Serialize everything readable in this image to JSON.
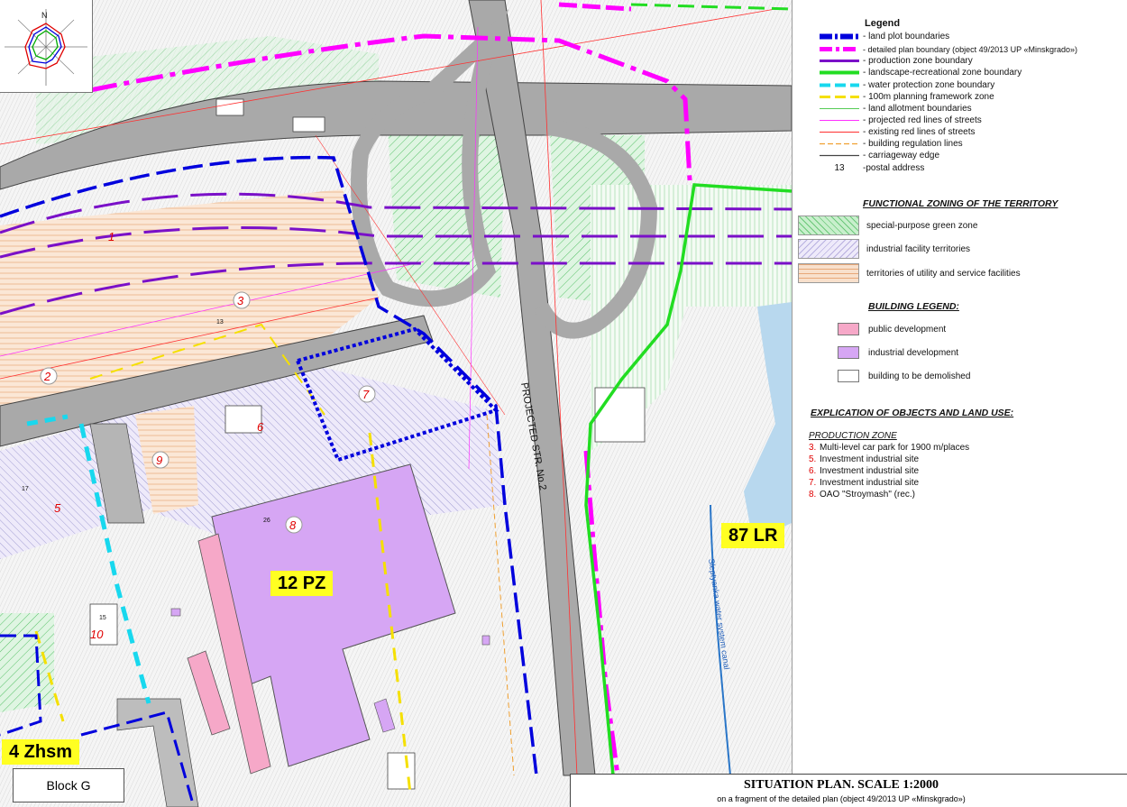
{
  "legend": {
    "title": "Legend",
    "items": [
      {
        "text": "- land plot boundaries",
        "color": "#0000dd",
        "style": "dash-bold"
      },
      {
        "text": "- detailed plan boundary (object 49/2013 UP «Minskgrado»)",
        "color": "#ff00ff",
        "style": "dashdot-bold"
      },
      {
        "text": "- production zone boundary",
        "color": "#7a10c8",
        "style": "solid"
      },
      {
        "text": "- landscape-recreational zone boundary",
        "color": "#22dd22",
        "style": "solid"
      },
      {
        "text": "- water protection zone boundary",
        "color": "#18d8ee",
        "style": "dash"
      },
      {
        "text": "- 100m planning framework zone",
        "color": "#f5e000",
        "style": "dash"
      },
      {
        "text": "- land allotment boundaries",
        "color": "#55cc55",
        "style": "thin"
      },
      {
        "text": "- projected red lines of streets",
        "color": "#ff30ff",
        "style": "thin"
      },
      {
        "text": "- existing red lines of streets",
        "color": "#ff3030",
        "style": "thin"
      },
      {
        "text": "- building regulation lines",
        "color": "#f0a030",
        "style": "thin-dash"
      },
      {
        "text": "- carriageway edge",
        "color": "#444444",
        "style": "thin"
      }
    ],
    "postal_number": "13",
    "postal_text": "-postal address"
  },
  "zoning": {
    "title": "FUNCTIONAL ZONING OF THE TERRITORY",
    "items": [
      {
        "text": "special-purpose green zone",
        "color": "#c8efcc"
      },
      {
        "text": "industrial facility territories",
        "color": "#eeeafa"
      },
      {
        "text": "territories of utility and service facilities",
        "color": "#f8e0cc"
      }
    ]
  },
  "buildings": {
    "title": "BUILDING LEGEND:",
    "items": [
      {
        "text": "public development",
        "color": "#f6a8c8"
      },
      {
        "text": "industrial development",
        "color": "#d6a6f4"
      },
      {
        "text": "building to be demolished",
        "color": "#ffffff"
      }
    ]
  },
  "explication": {
    "title": "EXPLICATION OF OBJECTS AND LAND USE:",
    "subtitle": "PRODUCTION ZONE",
    "items": [
      {
        "num": "3.",
        "text": "Multi-level car park for 1900 m/places"
      },
      {
        "num": "5.",
        "text": "Investment industrial site"
      },
      {
        "num": "6.",
        "text": "Investment industrial site"
      },
      {
        "num": "7.",
        "text": "Investment industrial site"
      },
      {
        "num": "8.",
        "text": "OAO \"Stroymash\" (rec.)"
      }
    ]
  },
  "map": {
    "compass_letter": "N",
    "street_label": "PROJECTED STR. No.2",
    "canal_label": "Sleptyanka water system canal",
    "zones": [
      {
        "label": "12 PZ",
        "color": "#ffff22"
      },
      {
        "label": "87 LR",
        "color": "#ffff22"
      },
      {
        "label": "4 Zhsm",
        "color": "#ffff22"
      }
    ],
    "block_label": "Block G",
    "plot_numbers": [
      "1",
      "2",
      "3",
      "5",
      "6",
      "7",
      "8",
      "9",
      "10"
    ],
    "addresses": [
      "13",
      "26",
      "17",
      "15"
    ]
  },
  "title_block": {
    "main": "SITUATION PLAN. SCALE 1:2000",
    "sub": "on a fragment of the detailed plan (object 49/2013 UP «Minskgrado»)"
  },
  "colors": {
    "land_plot": "#0000dd",
    "plan_boundary": "#ff00ff",
    "production_zone": "#7a10c8",
    "recreation_zone": "#22dd22",
    "water_zone": "#18d8ee",
    "planning_frame": "#f5e000",
    "road": "#aaaaaa",
    "industrial_building": "#d6a6f4",
    "public_building": "#f6a8c8",
    "water": "#b8d8ee"
  }
}
